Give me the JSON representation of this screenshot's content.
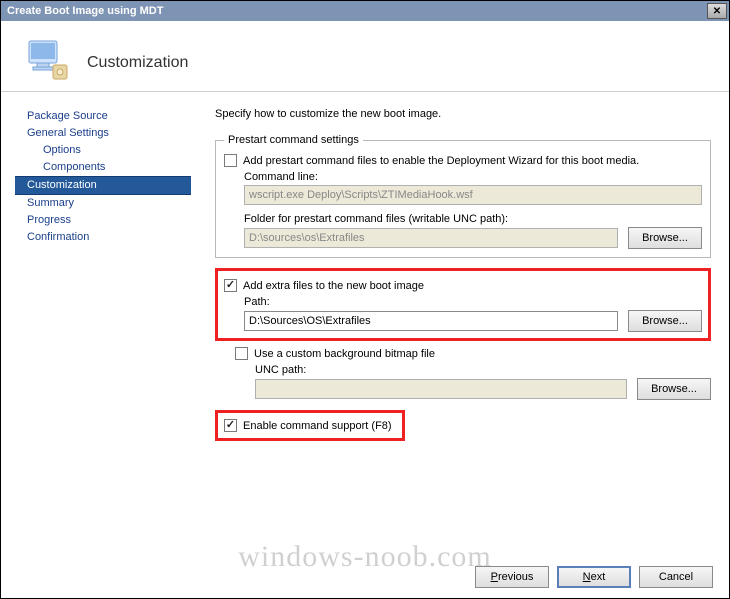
{
  "window": {
    "title": "Create Boot Image using MDT",
    "close_glyph": "✕"
  },
  "header": {
    "page_title": "Customization"
  },
  "sidebar": {
    "items": [
      {
        "label": "Package Source",
        "indent": false,
        "active": false
      },
      {
        "label": "General Settings",
        "indent": false,
        "active": false
      },
      {
        "label": "Options",
        "indent": true,
        "active": false
      },
      {
        "label": "Components",
        "indent": true,
        "active": false
      },
      {
        "label": "Customization",
        "indent": false,
        "active": true
      },
      {
        "label": "Summary",
        "indent": false,
        "active": false
      },
      {
        "label": "Progress",
        "indent": false,
        "active": false
      },
      {
        "label": "Confirmation",
        "indent": false,
        "active": false
      }
    ]
  },
  "content": {
    "intro": "Specify how to customize the new boot image.",
    "prestart_group": {
      "legend": "Prestart command settings",
      "chk_label": "Add prestart command files to enable the Deployment Wizard for this boot media.",
      "chk_checked": false,
      "cmd_label": "Command line:",
      "cmd_value": "wscript.exe Deploy\\Scripts\\ZTIMediaHook.wsf",
      "folder_label": "Folder for prestart command files (writable UNC path):",
      "folder_value": "D:\\sources\\os\\Extrafiles",
      "browse_label": "Browse..."
    },
    "extra_files": {
      "chk_label": "Add extra files to the new boot image",
      "chk_checked": true,
      "path_label": "Path:",
      "path_value": "D:\\Sources\\OS\\Extrafiles",
      "browse_label": "Browse..."
    },
    "bg_bitmap": {
      "chk_label": "Use a custom background bitmap file",
      "chk_checked": false,
      "path_label": "UNC path:",
      "path_value": "",
      "browse_label": "Browse..."
    },
    "cmd_support": {
      "chk_label": "Enable command support (F8)",
      "chk_checked": true
    }
  },
  "footer": {
    "previous": "Previous",
    "next": "Next",
    "cancel": "Cancel"
  },
  "watermark": "windows-noob.com"
}
